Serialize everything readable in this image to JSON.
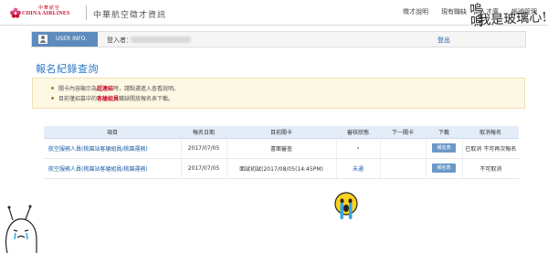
{
  "header": {
    "logo_cn": "中華航空",
    "logo_en": "CHINA AIRLINES",
    "site_title": "中華航空徵才資訊",
    "nav": [
      "徵才說明",
      "現有職缺",
      "人才庫",
      "帳號管理"
    ]
  },
  "handwriting": {
    "line1": "嗚嗚",
    "line2": "我是玻璃心!"
  },
  "user": {
    "label": "USER INFO.",
    "name_label": "登入者：",
    "logout": "登出"
  },
  "page_title": "報名紀錄查詢",
  "notice": {
    "line1_pre": "關卡內容顯示為",
    "line1_hl": "超連結",
    "line1_post": "時，請點選進入查看說明。",
    "line2_pre": "目前僅招募中的",
    "line2_hl": "客艙組員",
    "line2_post": "職缺開放報名表下載。"
  },
  "table": {
    "headers": [
      "項目",
      "報名日期",
      "目前關卡",
      "審核狀態",
      "下一關卡",
      "下載",
      "取消報名"
    ],
    "rows": [
      {
        "job": "航空服務人員(桃園站客艙組員/桃園運務)",
        "date": "2017/07/05",
        "stage": "書面審查",
        "status": "-",
        "next": "",
        "download": "報名表",
        "cancel": "已取消 不可再次報名"
      },
      {
        "job": "航空服務人員(桃園站客艙組員/桃園運務)",
        "date": "2017/07/05",
        "stage": "面試初試(2017/08/05(14:45PM)",
        "status": "未通",
        "next": "",
        "download": "報名表",
        "cancel": "不可取消"
      }
    ]
  },
  "colors": {
    "brand": "#c8102e",
    "accent": "#2b78c5",
    "header_bg": "#e4edf7",
    "notice_bg": "#fcf8e3"
  }
}
